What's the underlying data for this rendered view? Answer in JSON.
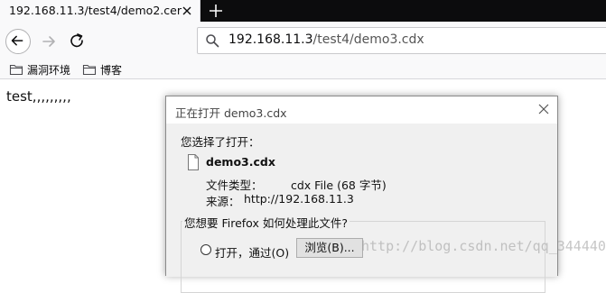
{
  "tab": {
    "title": "192.168.11.3/test4/demo2.cer",
    "close_icon": "close-icon",
    "new_tab_icon": "plus-icon"
  },
  "nav": {
    "back_icon": "back-arrow-icon",
    "forward_icon": "forward-arrow-icon",
    "reload_icon": "reload-icon"
  },
  "urlbar": {
    "icon": "search-icon",
    "host": "192.168.11.3",
    "path": "/test4/demo3.cdx"
  },
  "bookmarks": [
    {
      "label": "漏洞环境",
      "icon": "folder-icon"
    },
    {
      "label": "博客",
      "icon": "folder-icon"
    }
  ],
  "page": {
    "text": "test,,,,,,,,,"
  },
  "dialog": {
    "title": "正在打开 demo3.cdx",
    "intro": "您选择了打开：",
    "file_icon": "file-icon",
    "file_name": "demo3.cdx",
    "type_label": "文件类型：",
    "type_value": "cdx File (68 字节)",
    "source_label": "来源：",
    "source_value": "http://192.168.11.3",
    "question": "您想要 Firefox 如何处理此文件?",
    "open_with_label": "打开，通过(O)",
    "browse_label": "浏览(B)..."
  },
  "watermark": "http://blog.csdn.net/qq_34444097",
  "colors": {
    "tabbar": "#0c0c0d",
    "toolbar": "#f9f9fa",
    "dialog_body": "#f0f0f0"
  }
}
